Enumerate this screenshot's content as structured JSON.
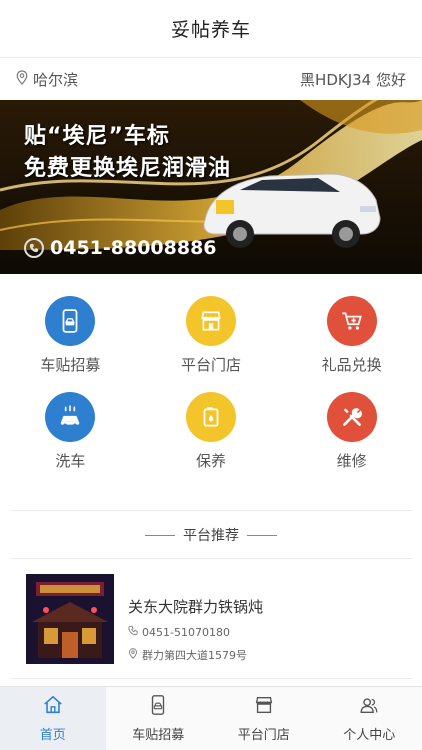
{
  "header": {
    "title": "妥帖养车"
  },
  "location": {
    "city": "哈尔滨",
    "greeting": "黑HDKJ34 您好"
  },
  "banner": {
    "headline": "贴“埃尼”车标",
    "subline": "免费更换埃尼润滑油",
    "phone": "0451-88008886"
  },
  "services": [
    {
      "label": "车贴招募",
      "icon": "phone-car-icon",
      "color": "#2f7fd0"
    },
    {
      "label": "平台门店",
      "icon": "storefront-icon",
      "color": "#f4c42b"
    },
    {
      "label": "礼品兑换",
      "icon": "cart-plus-icon",
      "color": "#e0503b"
    },
    {
      "label": "洗车",
      "icon": "car-wash-icon",
      "color": "#2f7fd0"
    },
    {
      "label": "保养",
      "icon": "oil-can-icon",
      "color": "#f4c42b"
    },
    {
      "label": "维修",
      "icon": "tools-icon",
      "color": "#e0503b"
    }
  ],
  "recommend": {
    "title": "平台推荐",
    "store": {
      "name": "关东大院群力铁锅炖",
      "phone": "0451-51070180",
      "address": "群力第四大道1579号"
    }
  },
  "tabs": [
    {
      "label": "首页",
      "icon": "home-icon"
    },
    {
      "label": "车贴招募",
      "icon": "phone-car-icon"
    },
    {
      "label": "平台门店",
      "icon": "storefront-icon"
    },
    {
      "label": "个人中心",
      "icon": "users-icon"
    }
  ],
  "colors": {
    "accent": "#2f7fd0",
    "yellow": "#f4c42b",
    "red": "#e0503b"
  }
}
